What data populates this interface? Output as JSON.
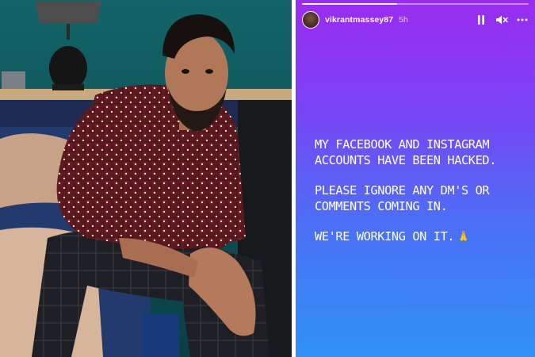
{
  "photo": {
    "description_icon": "person-photo"
  },
  "story": {
    "progress_fraction": 0.42,
    "account": {
      "username": "vikrantmassey87",
      "time_ago": "5h"
    },
    "controls": {
      "pause_icon": "pause-icon",
      "mute_icon": "mute-icon",
      "more_icon": "more-icon"
    },
    "text_lines": [
      "MY FACEBOOK AND INSTAGRAM ACCOUNTS HAVE BEEN HACKED.",
      "PLEASE IGNORE ANY DM'S OR COMMENTS COMING IN.",
      "WE'RE WORKING ON IT."
    ],
    "emoji": "🙏",
    "colors": {
      "gradient_top": "#9b2cf0",
      "gradient_mid": "#4d6ef6",
      "gradient_bottom": "#2f92f6"
    }
  }
}
